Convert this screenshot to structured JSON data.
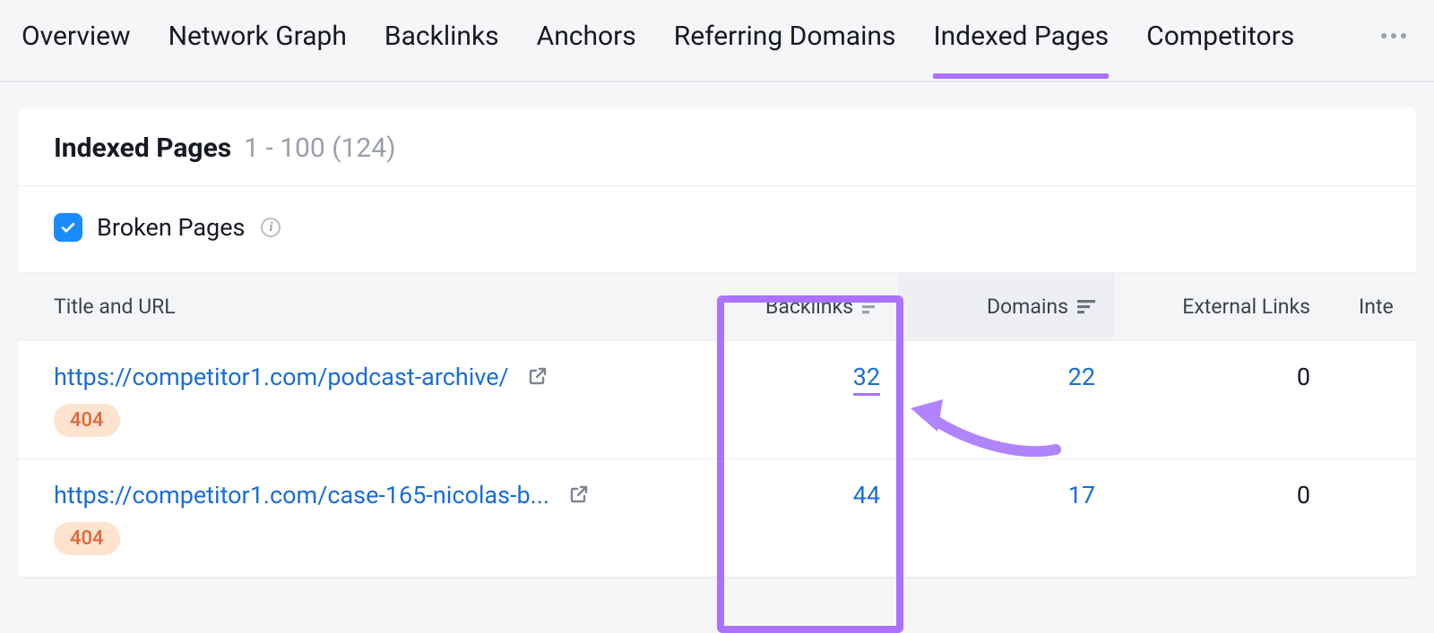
{
  "tabs": {
    "items": [
      {
        "label": "Overview"
      },
      {
        "label": "Network Graph"
      },
      {
        "label": "Backlinks"
      },
      {
        "label": "Anchors"
      },
      {
        "label": "Referring Domains"
      },
      {
        "label": "Indexed Pages"
      },
      {
        "label": "Competitors"
      }
    ],
    "active_index": 5
  },
  "header": {
    "title": "Indexed Pages",
    "range": "1 - 100 (124)"
  },
  "filter": {
    "broken_pages_label": "Broken Pages",
    "broken_pages_checked": true
  },
  "table": {
    "columns": {
      "title_url": "Title and URL",
      "backlinks": "Backlinks",
      "domains": "Domains",
      "external_links": "External Links",
      "internal_links": "Inte"
    },
    "rows": [
      {
        "url": "https://competitor1.com/podcast-archive/",
        "status": "404",
        "backlinks": "32",
        "domains": "22",
        "external": "0"
      },
      {
        "url": "https://competitor1.com/case-165-nicolas-b...",
        "status": "404",
        "backlinks": "44",
        "domains": "17",
        "external": "0"
      }
    ]
  },
  "colors": {
    "accent_purple": "#a972ff",
    "link_blue": "#1a6dd6",
    "checkbox_blue": "#1a8cff",
    "badge_bg": "#ffe3cf",
    "badge_text": "#e0683a"
  }
}
